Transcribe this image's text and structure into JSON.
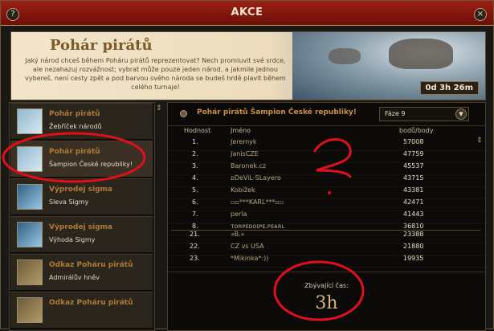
{
  "window": {
    "title": "AKCE",
    "help_icon": "question-icon",
    "close_icon": "close-icon"
  },
  "banner": {
    "title": "Pohár pirátů",
    "text": "Jaký národ chceš během Poháru pirátů reprezentovat? Nech promluvit své srdce, ale nezahazuj rozvážnost; vybrat může pouze jeden národ, a jakmile jednou vybereš, není cesty zpět a pod barvou svého národa se budeš hrdě plavit během celého turnaje!",
    "timer": "0d 3h 26m"
  },
  "sidebar": {
    "items": [
      {
        "title": "Pohár pirátů",
        "subtitle": "Žebříček národů",
        "icon": "trophy-icon"
      },
      {
        "title": "Pohár pirátů",
        "subtitle": "Šampion České republiky!",
        "icon": "trophy-icon"
      },
      {
        "title": "Výprodej sigma",
        "subtitle": "Sleva Sigmy",
        "icon": "sigma-icon"
      },
      {
        "title": "Výprodej sigma",
        "subtitle": "Výhoda Sigmy",
        "icon": "sigma-icon"
      },
      {
        "title": "Odkaz Poháru pirátů",
        "subtitle": "Admirálův hněv",
        "icon": "admiral-icon"
      },
      {
        "title": "Odkaz Poháru pirátů",
        "subtitle": "",
        "icon": "admiral-icon"
      }
    ]
  },
  "main": {
    "title": "Pohár pirátů Šampion České republiky!",
    "phase": "Fáze 9",
    "columns": {
      "rank": "Hodnost",
      "name": "Jméno",
      "points": "bodů/body"
    },
    "rows": [
      {
        "rank": "1.",
        "name": "Jeremyk",
        "points": "57008"
      },
      {
        "rank": "2.",
        "name": "JanisCZE",
        "points": "47759"
      },
      {
        "rank": "3.",
        "name": "Baronek.cz",
        "points": "45537"
      },
      {
        "rank": "4.",
        "name": "ᴅDeViL-SLayerᴅ",
        "points": "43715"
      },
      {
        "rank": "5.",
        "name": "Kobížek",
        "points": "43381"
      },
      {
        "rank": "6.",
        "name": "▫▫***KARL***▫▫",
        "points": "42471"
      },
      {
        "rank": "7.",
        "name": "perla",
        "points": "41443"
      },
      {
        "rank": "8.",
        "name": "ᴛᴏʀᴘᴇᴅᴏɪᴘᴇ.ᴘᴇᴀʀʟ",
        "points": "36810"
      }
    ],
    "own_rows": [
      {
        "rank": "21.",
        "name": "»B.»",
        "points": "23388"
      },
      {
        "rank": "22.",
        "name": "CZ vs USA",
        "points": "21880"
      },
      {
        "rank": "23.",
        "name": "*Mikinka*:))",
        "points": "19935"
      }
    ],
    "remaining_label": "Zbývající čas:",
    "remaining_value": "3h"
  },
  "colors": {
    "annotation": "#e0101a",
    "accent": "#c9913a",
    "titlebar": "#8b1a10"
  }
}
